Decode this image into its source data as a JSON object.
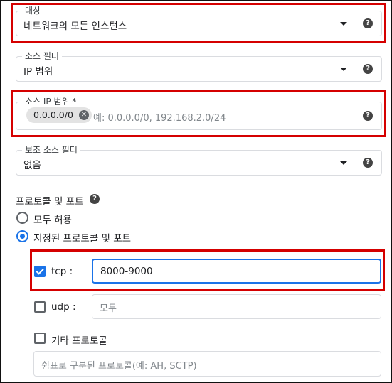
{
  "target": {
    "label": "대상",
    "value": "네트워크의 모든 인스턴스"
  },
  "source_filter": {
    "label": "소스 필터",
    "value": "IP 범위"
  },
  "source_ip_range": {
    "label": "소스 IP 범위 *",
    "chip": "0.0.0.0/0",
    "placeholder": "예: 0.0.0.0/0, 192.168.2.0/24"
  },
  "secondary_source_filter": {
    "label": "보조 소스 필터",
    "value": "없음"
  },
  "protocols": {
    "title": "프로토콜 및 포트",
    "allow_all_label": "모두 허용",
    "specified_label": "지정된 프로토콜 및 포트",
    "tcp": {
      "label": "tcp :",
      "value": "8000-9000",
      "checked": true
    },
    "udp": {
      "label": "udp :",
      "placeholder": "모두",
      "checked": false
    },
    "other": {
      "label": "기타 프로토콜",
      "placeholder": "쉼표로 구분된 프로토콜(예: AH, SCTP)",
      "checked": false
    }
  },
  "colors": {
    "accent": "#1a73e8",
    "highlight": "#d50000"
  }
}
